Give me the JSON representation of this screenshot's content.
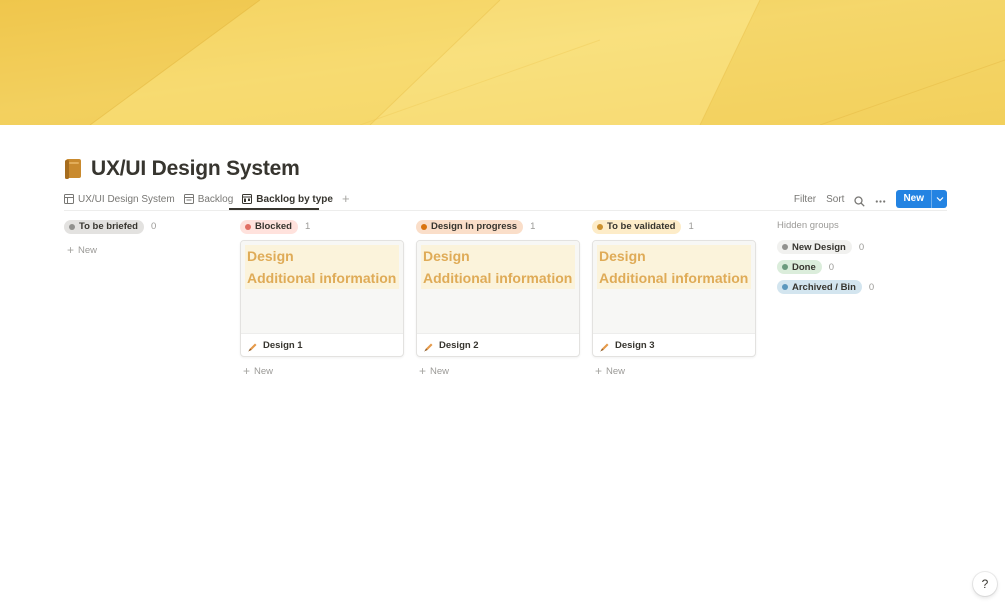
{
  "page": {
    "title": "UX/UI Design System",
    "icon": "book-icon"
  },
  "tabs": [
    {
      "label": "UX/UI Design System",
      "icon": "table-icon",
      "active": false
    },
    {
      "label": "Backlog",
      "icon": "list-board-icon",
      "active": false
    },
    {
      "label": "Backlog by type",
      "icon": "board-icon",
      "active": true
    }
  ],
  "toolbar": {
    "filter_label": "Filter",
    "sort_label": "Sort",
    "new_label": "New"
  },
  "columns": [
    {
      "label": "To be briefed",
      "count": "0",
      "pill_color": "#e3e2e0",
      "dot_color": "#91918e",
      "add_label": "New",
      "card": null
    },
    {
      "label": "Blocked",
      "count": "1",
      "pill_color": "#ffe2dd",
      "dot_color": "#e16f64",
      "add_label": "New",
      "card": {
        "preview_line1": "Design",
        "preview_line2": "Additional information",
        "title": "Design 1"
      }
    },
    {
      "label": "Design In progress",
      "count": "1",
      "pill_color": "#fadec9",
      "dot_color": "#d9730d",
      "add_label": "New",
      "card": {
        "preview_line1": "Design",
        "preview_line2": "Additional information",
        "title": "Design 2"
      }
    },
    {
      "label": "To be validated",
      "count": "1",
      "pill_color": "#fdecc8",
      "dot_color": "#cb912f",
      "add_label": "New",
      "card": {
        "preview_line1": "Design",
        "preview_line2": "Additional information",
        "title": "Design 3"
      }
    }
  ],
  "hidden_groups": {
    "title": "Hidden groups",
    "items": [
      {
        "label": "New Design",
        "count": "0",
        "pill_color": "#f1f1ef",
        "dot_color": "#91918e"
      },
      {
        "label": "Done",
        "count": "0",
        "pill_color": "#dbeddb",
        "dot_color": "#6c9b7d"
      },
      {
        "label": "Archived / Bin",
        "count": "0",
        "pill_color": "#d3e5ef",
        "dot_color": "#5b97bd"
      }
    ]
  },
  "help_label": "?",
  "colors": {
    "cover": "#f5d866",
    "accent": "#2383e2",
    "preview_text": "#dfab57",
    "preview_bg": "#fbf3db"
  }
}
